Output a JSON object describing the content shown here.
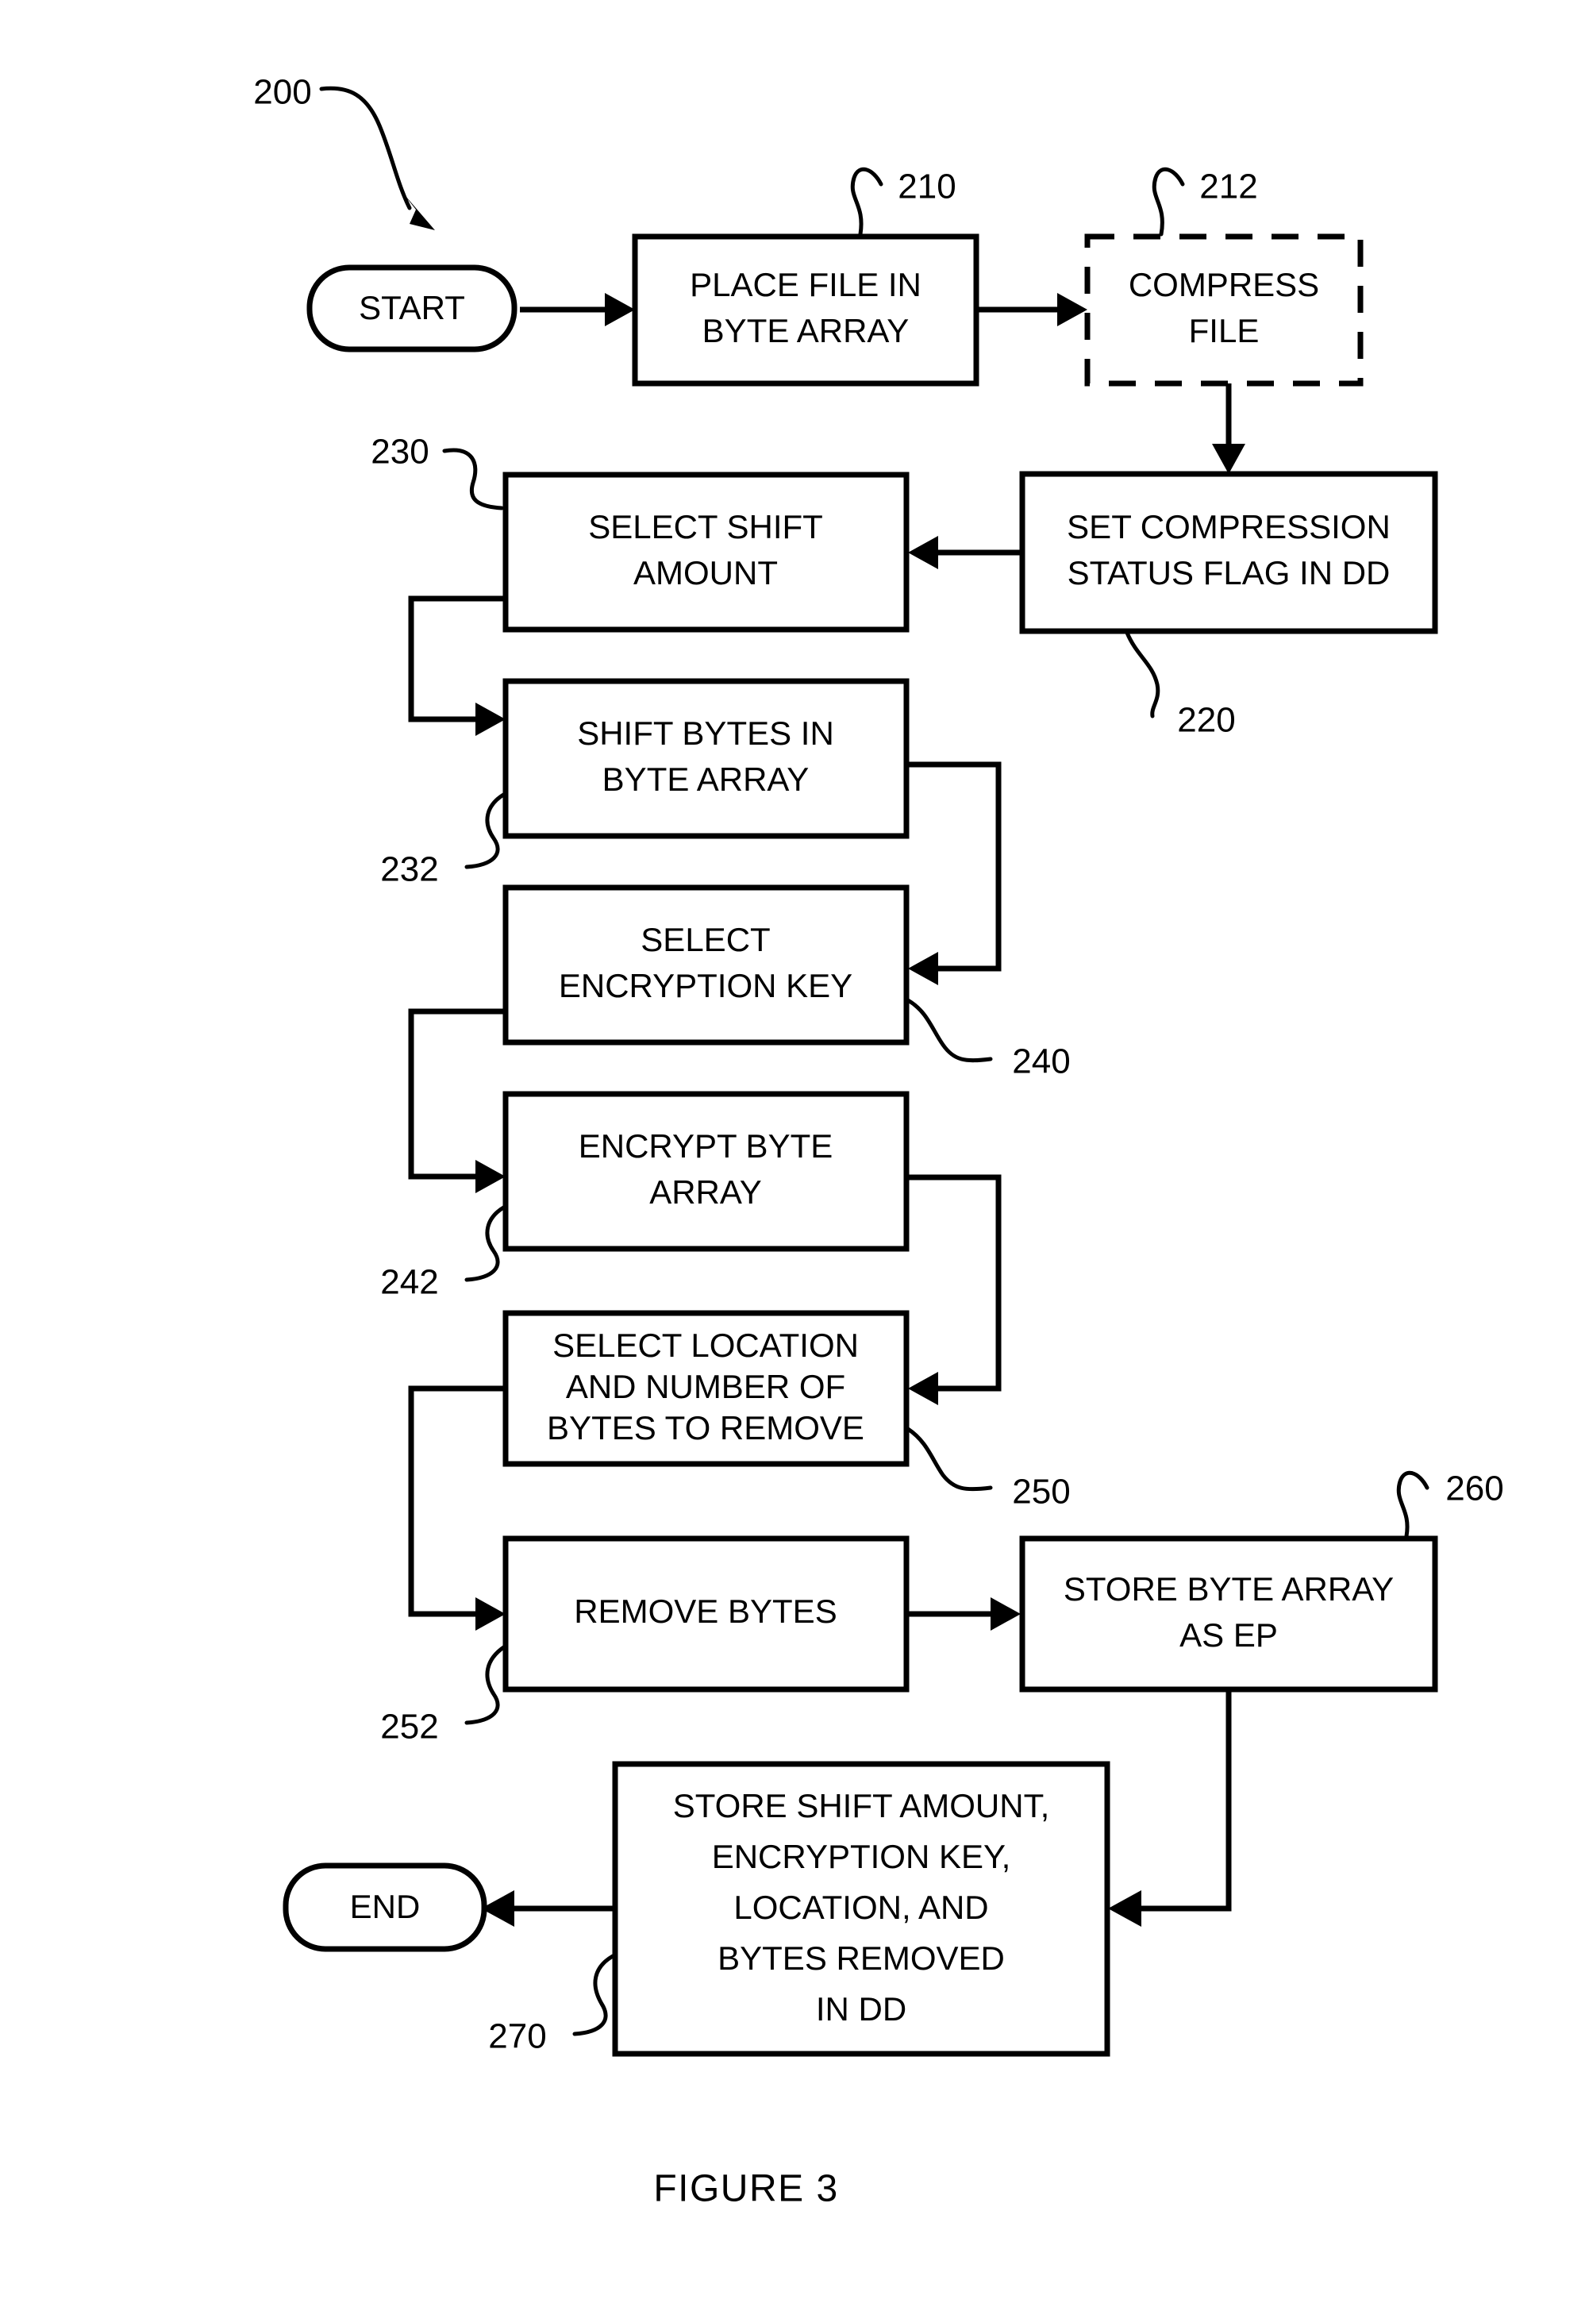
{
  "figure": {
    "caption": "FIGURE 3",
    "diagram_ref": "200"
  },
  "nodes": {
    "start": {
      "label": "START",
      "shape": "terminal"
    },
    "place_file": {
      "label_line1": "PLACE FILE IN",
      "label_line2": "BYTE ARRAY",
      "ref": "210",
      "shape": "process"
    },
    "compress_file": {
      "label_line1": "COMPRESS",
      "label_line2": "FILE",
      "ref": "212",
      "shape": "optional-process"
    },
    "set_compression": {
      "label_line1": "SET COMPRESSION",
      "label_line2": "STATUS FLAG IN DD",
      "ref": "220",
      "shape": "process"
    },
    "select_shift": {
      "label_line1": "SELECT SHIFT",
      "label_line2": "AMOUNT",
      "ref": "230",
      "shape": "process"
    },
    "shift_bytes": {
      "label_line1": "SHIFT BYTES IN",
      "label_line2": "BYTE ARRAY",
      "ref": "232",
      "shape": "process"
    },
    "select_key": {
      "label_line1": "SELECT",
      "label_line2": "ENCRYPTION KEY",
      "ref": "240",
      "shape": "process"
    },
    "encrypt_array": {
      "label_line1": "ENCRYPT BYTE",
      "label_line2": "ARRAY",
      "ref": "242",
      "shape": "process"
    },
    "select_location": {
      "label_line1": "SELECT LOCATION",
      "label_line2": "AND NUMBER OF",
      "label_line3": "BYTES TO REMOVE",
      "ref": "250",
      "shape": "process"
    },
    "remove_bytes": {
      "label_line1": "REMOVE BYTES",
      "ref": "252",
      "shape": "process"
    },
    "store_ep": {
      "label_line1": "STORE BYTE ARRAY",
      "label_line2": "AS EP",
      "ref": "260",
      "shape": "process"
    },
    "store_dd": {
      "label_line1": "STORE SHIFT AMOUNT,",
      "label_line2": "ENCRYPTION KEY,",
      "label_line3": "LOCATION, AND",
      "label_line4": "BYTES REMOVED",
      "label_line5": "IN DD",
      "ref": "270",
      "shape": "process"
    },
    "end": {
      "label": "END",
      "shape": "terminal"
    }
  },
  "colors": {
    "stroke": "#000000",
    "fill": "#ffffff",
    "text": "#000000"
  },
  "chart_data": {
    "type": "flowchart",
    "title": "FIGURE 3",
    "diagram_number": "200",
    "nodes": [
      {
        "ref": "",
        "text": "START",
        "type": "terminal"
      },
      {
        "ref": "210",
        "text": "PLACE FILE IN BYTE ARRAY",
        "type": "process"
      },
      {
        "ref": "212",
        "text": "COMPRESS FILE",
        "type": "optional-process"
      },
      {
        "ref": "220",
        "text": "SET COMPRESSION STATUS FLAG IN DD",
        "type": "process"
      },
      {
        "ref": "230",
        "text": "SELECT SHIFT AMOUNT",
        "type": "process"
      },
      {
        "ref": "232",
        "text": "SHIFT BYTES IN BYTE ARRAY",
        "type": "process"
      },
      {
        "ref": "240",
        "text": "SELECT ENCRYPTION KEY",
        "type": "process"
      },
      {
        "ref": "242",
        "text": "ENCRYPT BYTE ARRAY",
        "type": "process"
      },
      {
        "ref": "250",
        "text": "SELECT LOCATION AND NUMBER OF BYTES TO REMOVE",
        "type": "process"
      },
      {
        "ref": "252",
        "text": "REMOVE BYTES",
        "type": "process"
      },
      {
        "ref": "260",
        "text": "STORE BYTE ARRAY AS EP",
        "type": "process"
      },
      {
        "ref": "270",
        "text": "STORE SHIFT AMOUNT, ENCRYPTION KEY, LOCATION, AND BYTES REMOVED IN DD",
        "type": "process"
      },
      {
        "ref": "",
        "text": "END",
        "type": "terminal"
      }
    ],
    "edges": [
      {
        "from": "START",
        "to": "210"
      },
      {
        "from": "210",
        "to": "212"
      },
      {
        "from": "212",
        "to": "220"
      },
      {
        "from": "220",
        "to": "230"
      },
      {
        "from": "230",
        "to": "232"
      },
      {
        "from": "232",
        "to": "240"
      },
      {
        "from": "240",
        "to": "242"
      },
      {
        "from": "242",
        "to": "250"
      },
      {
        "from": "250",
        "to": "252"
      },
      {
        "from": "252",
        "to": "260"
      },
      {
        "from": "260",
        "to": "270"
      },
      {
        "from": "270",
        "to": "END"
      }
    ]
  }
}
